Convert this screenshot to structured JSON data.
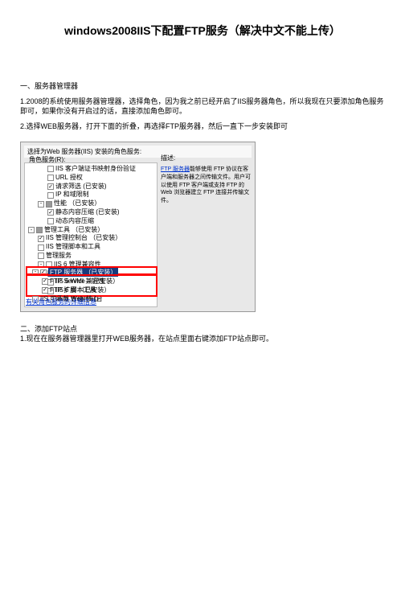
{
  "title": "windows2008IIS下配置FTP服务（解决中文不能上传）",
  "sec1_heading": "一、服务器管理器",
  "sec1_p1": "1.2008的系统使用服务器管理器，选择角色，因为我之前已经开启了IIS服务器角色，所以我现在只要添加角色服务即可，如果你没有开启过的话，直接添加角色即可。",
  "sec1_p2": "2.选择WEB服务器，打开下面的折叠，再选择FTP服务器，然后一直下一步安装即可",
  "tree_header": "选择为Web 服务器(IIS) 安装的角色服务:",
  "tree_sub": "角色服务(R):",
  "right_header": "描述:",
  "right_desc_link": "FTP 服务器",
  "right_desc_rest": "能够使用 FTP 协议在客户端和服务器之间传输文件。用户可以使用 FTP 客户端或支持 FTP 的 Web 浏览器建立 FTP 连接并传输文件。",
  "bottom_link": "有关角色服务的详细信息",
  "tree": {
    "item0": "IIS 客户端证书映射身份验证",
    "item1": "URL 授权",
    "item2": "请求筛选 (已安装)",
    "item3": "IP 和域限制",
    "group1": "性能 （已安装）",
    "item4": "静态内容压缩 (已安装)",
    "item5": "动态内容压缩",
    "group2": "管理工具 （已安装）",
    "item6": "IIS 管理控制台 （已安装）",
    "item7": "IIS 管理脚本和工具",
    "item8": "管理服务",
    "group3": "IIS 6 管理兼容性",
    "item9": "IIS 6 元数据库兼容性",
    "item10": "IIS 6 WMI 兼容性",
    "item11": "IIS 6 脚本工具",
    "item12": "IIS 6 管理控制台",
    "ftp_group": "FTP 服务器 （已安装）",
    "ftp1": "FTP Service （已安装）",
    "ftp2": "FTP 扩展 （已安装）",
    "last": "IIS 可承载 Web 核心"
  },
  "sec2_heading": "二、添加FTP站点",
  "sec2_p1": "1.现在在服务器管理器里打开WEB服务器，在站点里面右键添加FTP站点即可。"
}
